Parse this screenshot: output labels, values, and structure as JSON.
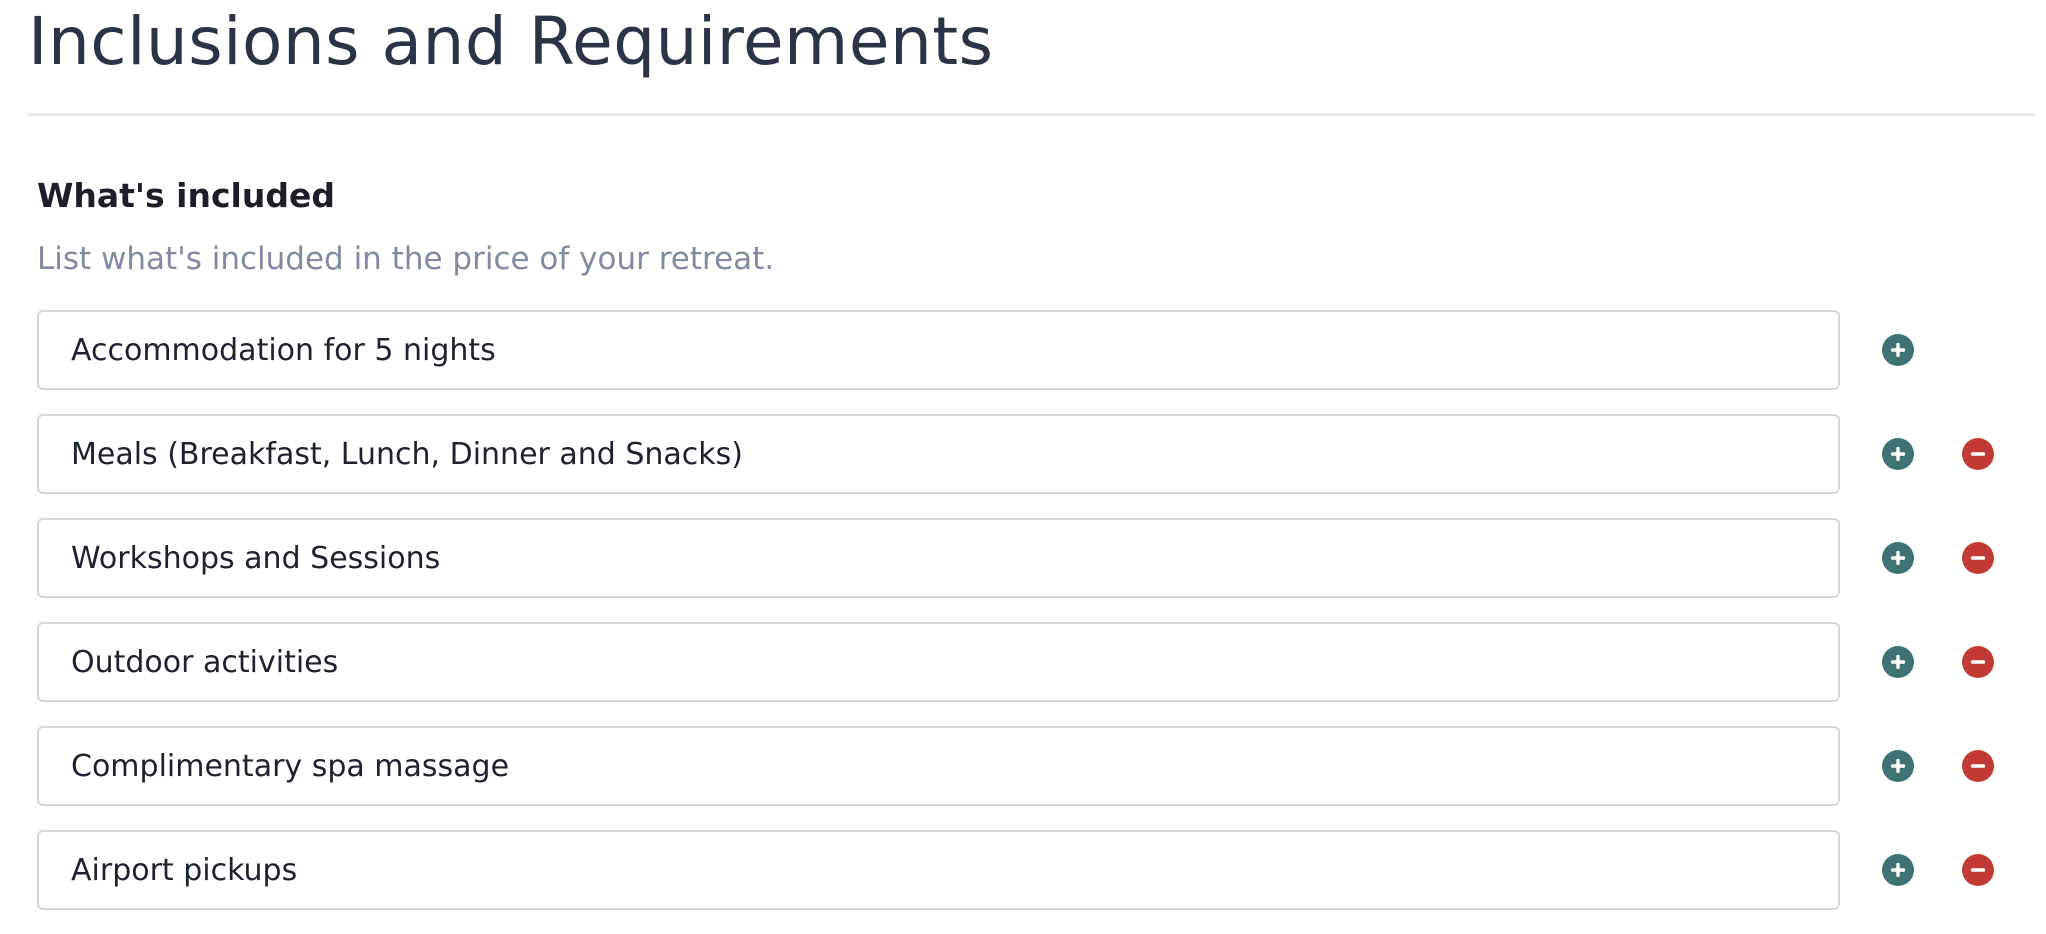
{
  "page": {
    "title": "Inclusions and Requirements"
  },
  "included": {
    "heading": "What's included",
    "help": "List what's included in the price of your retreat.",
    "items": [
      {
        "value": "Accommodation for 5 nights",
        "removable": false
      },
      {
        "value": "Meals (Breakfast, Lunch, Dinner and Snacks)",
        "removable": true
      },
      {
        "value": "Workshops and Sessions",
        "removable": true
      },
      {
        "value": "Outdoor activities",
        "removable": true
      },
      {
        "value": "Complimentary spa massage",
        "removable": true
      },
      {
        "value": "Airport pickups",
        "removable": true
      }
    ]
  },
  "icons": {
    "add": "plus-circle-icon",
    "remove": "minus-circle-icon"
  },
  "colors": {
    "title": "#2b3447",
    "help_text": "#7f8aa3",
    "add_button": "#3f7274",
    "remove_button": "#c23a36",
    "input_border": "#d4d8dd"
  }
}
